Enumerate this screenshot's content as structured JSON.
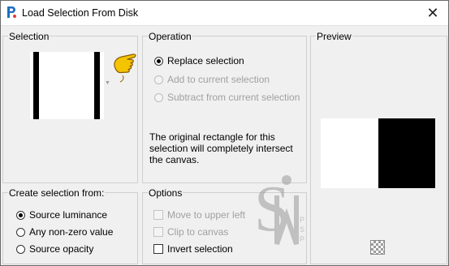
{
  "window": {
    "title": "Load Selection From Disk",
    "close_glyph": "✕"
  },
  "selection": {
    "title": "Selection"
  },
  "operation": {
    "title": "Operation",
    "options": [
      {
        "label": "Replace selection",
        "checked": true,
        "enabled": true
      },
      {
        "label": "Add to current selection",
        "checked": false,
        "enabled": false
      },
      {
        "label": "Subtract from current selection",
        "checked": false,
        "enabled": false
      }
    ],
    "info_lines": [
      "The original rectangle for this",
      "selection will completely intersect",
      "the canvas."
    ]
  },
  "preview": {
    "title": "Preview"
  },
  "create_from": {
    "title": "Create selection from:",
    "options": [
      {
        "label": "Source luminance",
        "checked": true
      },
      {
        "label": "Any non-zero value",
        "checked": false
      },
      {
        "label": "Source opacity",
        "checked": false
      }
    ]
  },
  "options": {
    "title": "Options",
    "items": [
      {
        "label": "Move to upper left",
        "enabled": false,
        "checked": false
      },
      {
        "label": "Clip to canvas",
        "enabled": false,
        "checked": false
      },
      {
        "label": "Invert selection",
        "enabled": true,
        "checked": false
      }
    ]
  },
  "watermark": {
    "letters": [
      "P",
      "S",
      "P"
    ]
  },
  "icons": {
    "app": "paintshop-pro-icon",
    "pointer": "pointing-hand-icon",
    "dropdown": "dropdown-arrow-icon",
    "checker": "checkerboard-icon"
  },
  "colors": {
    "pointer_fill": "#f5c400",
    "pointer_outline": "#8a5a00",
    "app_icon": "#1f6fbf"
  }
}
